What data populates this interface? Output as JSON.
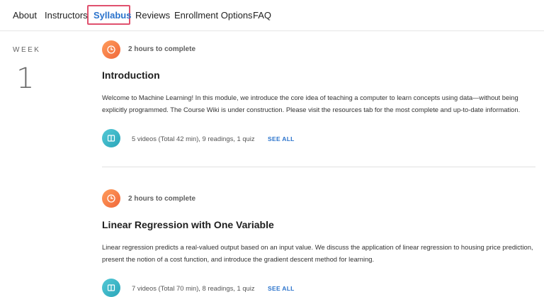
{
  "nav": {
    "items": [
      {
        "label": "About",
        "active": false
      },
      {
        "label": "Instructors",
        "active": false
      },
      {
        "label": "Syllabus",
        "active": true
      },
      {
        "label": "Reviews",
        "active": false
      },
      {
        "label": "Enrollment Options",
        "active": false
      },
      {
        "label": "FAQ",
        "active": false
      }
    ]
  },
  "week": {
    "label": "WEEK",
    "number": "1"
  },
  "modules": [
    {
      "time": "2 hours to complete",
      "title": "Introduction",
      "description": "Welcome to Machine Learning! In this module, we introduce the core idea of teaching a computer to learn concepts using data—without being explicitly programmed. The Course Wiki is under construction. Please visit the resources tab for the most complete and up-to-date information.",
      "summary": "5 videos (Total 42 min), 9 readings, 1 quiz",
      "see_all": "SEE ALL"
    },
    {
      "time": "2 hours to complete",
      "title": "Linear Regression with One Variable",
      "description": "Linear regression predicts a real-valued output based on an input value. We discuss the application of linear regression to housing price prediction, present the notion of a cost function, and introduce the gradient descent method for learning.",
      "summary": "7 videos (Total 70 min), 8 readings, 1 quiz",
      "see_all": "SEE ALL"
    }
  ],
  "colors": {
    "accent": "#2a73cc",
    "highlight": "#e0516e",
    "clock": "#f0663a",
    "content": "#2aa5b9"
  }
}
